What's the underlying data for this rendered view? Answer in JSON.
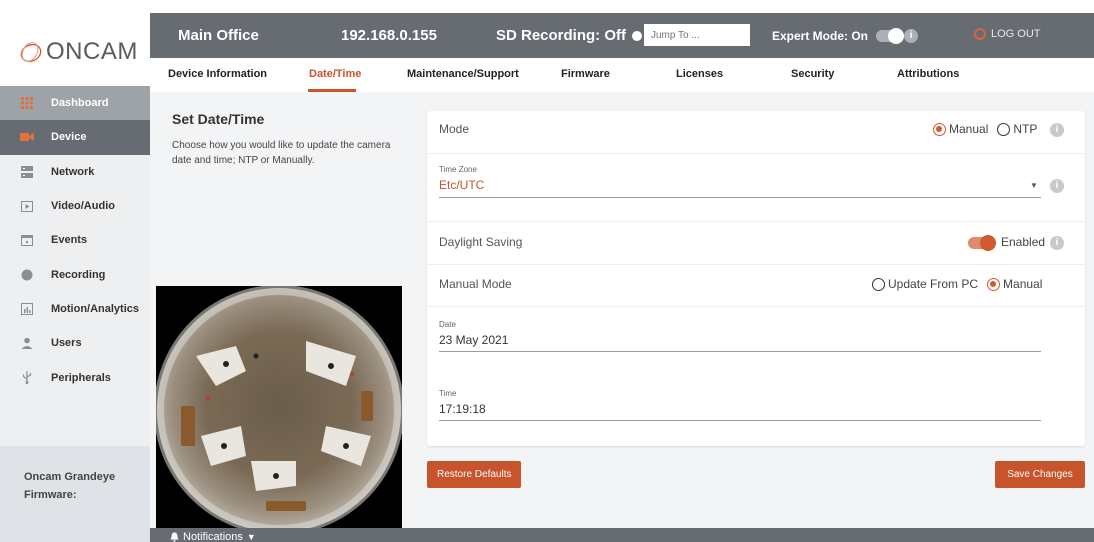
{
  "brand": {
    "logo_text": "ONCAM",
    "accent": "#c8532d"
  },
  "header": {
    "location": "Main Office",
    "ip": "192.168.0.155",
    "sd_recording": "SD Recording: Off",
    "jump_placeholder": "Jump To ...",
    "expert_mode": "Expert Mode: On",
    "expert_mode_on": true,
    "logout": "LOG OUT"
  },
  "tabs": [
    {
      "label": "Device Information",
      "active": false
    },
    {
      "label": "Date/Time",
      "active": true
    },
    {
      "label": "Maintenance/Support",
      "active": false
    },
    {
      "label": "Firmware",
      "active": false
    },
    {
      "label": "Licenses",
      "active": false
    },
    {
      "label": "Security",
      "active": false
    },
    {
      "label": "Attributions",
      "active": false
    }
  ],
  "sidebar": {
    "items": [
      {
        "label": "Dashboard",
        "icon": "grid-icon"
      },
      {
        "label": "Device",
        "icon": "camera-icon"
      },
      {
        "label": "Network",
        "icon": "server-icon"
      },
      {
        "label": "Video/Audio",
        "icon": "play-icon"
      },
      {
        "label": "Events",
        "icon": "calendar-icon"
      },
      {
        "label": "Recording",
        "icon": "record-icon"
      },
      {
        "label": "Motion/Analytics",
        "icon": "bar-chart-icon"
      },
      {
        "label": "Users",
        "icon": "user-icon"
      },
      {
        "label": "Peripherals",
        "icon": "usb-icon"
      }
    ],
    "footer": {
      "model": "Oncam Grandeye",
      "firmware_label": "Firmware:"
    }
  },
  "main": {
    "title": "Set Date/Time",
    "description": "Choose how you would like to update the camera date and time; NTP or Manually.",
    "mode": {
      "label": "Mode",
      "options": [
        "Manual",
        "NTP"
      ],
      "selected": "Manual"
    },
    "timezone": {
      "label": "Time Zone",
      "value": "Etc/UTC"
    },
    "daylight": {
      "label": "Daylight Saving",
      "state": "Enabled",
      "on": true
    },
    "manual_mode": {
      "label": "Manual Mode",
      "options": [
        "Update From PC",
        "Manual"
      ],
      "selected": "Manual"
    },
    "date": {
      "label": "Date",
      "value": "23 May 2021"
    },
    "time": {
      "label": "Time",
      "value": "17:19:18"
    },
    "buttons": {
      "restore": "Restore Defaults",
      "save": "Save Changes"
    }
  },
  "footer": {
    "notifications": "Notifications"
  }
}
